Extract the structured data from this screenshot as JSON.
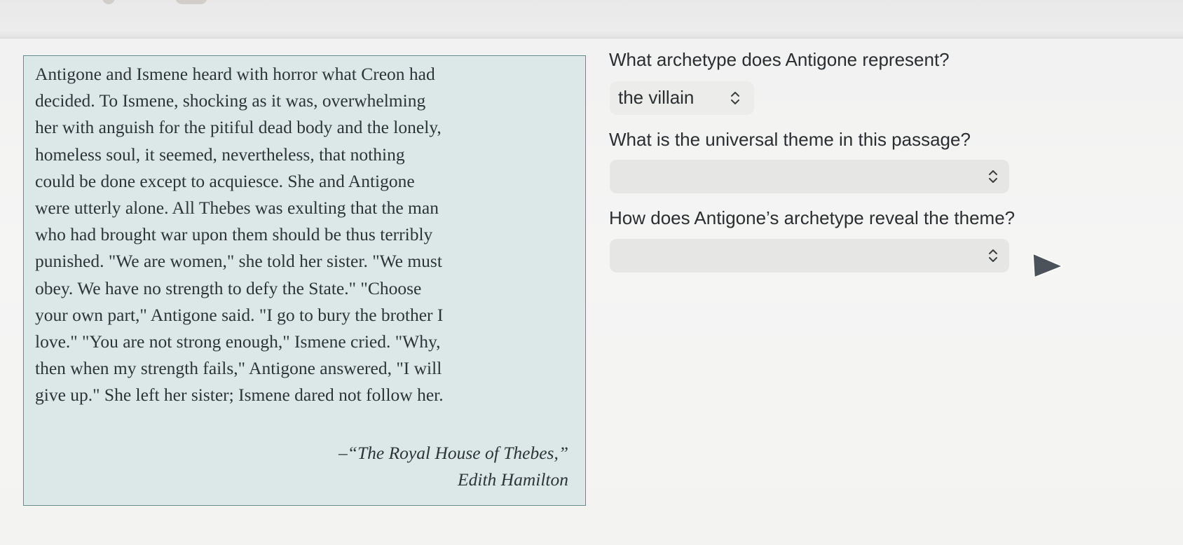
{
  "passage": {
    "lines": [
      "Antigone and Ismene heard with horror what Creon had",
      "decided. To Ismene, shocking as it was, overwhelming",
      "her with anguish for the pitiful dead body and the lonely,",
      "homeless soul, it seemed, nevertheless, that nothing",
      "could be done except to acquiesce. She and Antigone",
      "were utterly alone. All Thebes was exulting that the man",
      "who had brought war upon them should be thus terribly",
      "punished. \"We are women,\" she told her sister. \"We must",
      "obey. We have no strength to defy the State.\" \"Choose",
      "your own part,\" Antigone said. \"I go to bury the brother I",
      "love.\" \"You are not strong enough,\" Ismene cried. \"Why,",
      "then when my strength fails,\" Antigone answered, \"I will",
      "give up.\" She left her sister; Ismene dared not follow her."
    ],
    "attribution_title": "–“The Royal House of Thebes,”",
    "attribution_author": "Edith Hamilton"
  },
  "questions": [
    {
      "prompt": "What archetype does Antigone represent?",
      "selected": "the villain"
    },
    {
      "prompt": "What is the universal theme in this passage?",
      "selected": ""
    },
    {
      "prompt": "How does Antigone’s archetype reveal the theme?",
      "selected": ""
    }
  ],
  "icons": {
    "select_indicator": "up-down-chevron-icon",
    "pointer": "mouse-pointer-icon"
  },
  "colors": {
    "passage_background": "#dce7e8",
    "passage_border": "#5f8a86",
    "select_background": "#e6e7e4",
    "text": "#2a2e31"
  }
}
